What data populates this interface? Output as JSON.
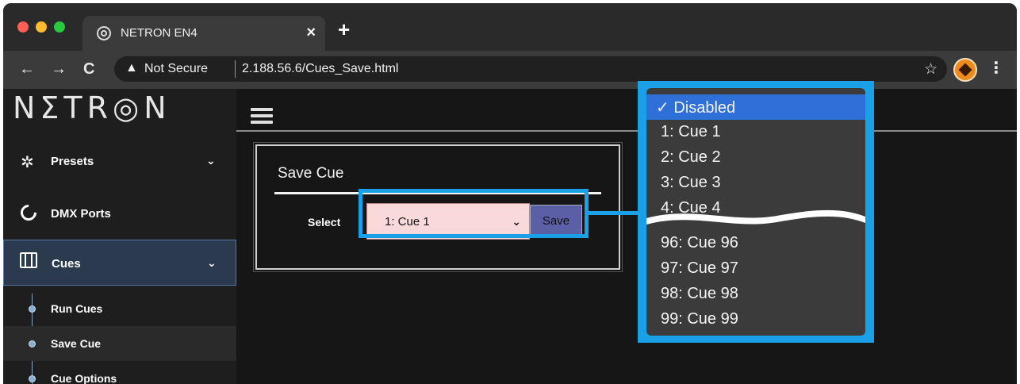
{
  "browser": {
    "tab_title": "NETRON EN4",
    "tab_close": "×",
    "new_tab": "+",
    "back": "←",
    "forward": "→",
    "reload": "C",
    "warning_icon": "▲",
    "security_text": "Not Secure",
    "url": "2.188.56.6/Cues_Save.html",
    "star": "☆",
    "menu": "⋮",
    "traffic_lights": [
      "#ff5f57",
      "#febc2e",
      "#28c840"
    ]
  },
  "app": {
    "logo": "NΣTR◎N"
  },
  "sidebar": {
    "items": [
      {
        "label": "Presets",
        "chevron": "⌄"
      },
      {
        "label": "DMX Ports"
      },
      {
        "label": "Cues",
        "chevron": "⌄"
      }
    ],
    "sub_items": [
      {
        "label": "Run Cues"
      },
      {
        "label": "Save Cue"
      },
      {
        "label": "Cue Options"
      }
    ]
  },
  "panel": {
    "title": "Save Cue",
    "select_label": "Select",
    "select_value": "1: Cue 1",
    "select_arrow": "⌄",
    "save_label": "Save"
  },
  "dropdown": {
    "checked": "✓ Disabled",
    "top_options": [
      "1: Cue 1",
      "2: Cue 2",
      "3: Cue 3",
      "4: Cue 4"
    ],
    "bottom_options": [
      "96: Cue 96",
      "97: Cue 97",
      "98: Cue 98",
      "99: Cue 99"
    ]
  },
  "colors": {
    "highlight": "#1aa0e6",
    "selected_option": "#2f6fd8"
  }
}
